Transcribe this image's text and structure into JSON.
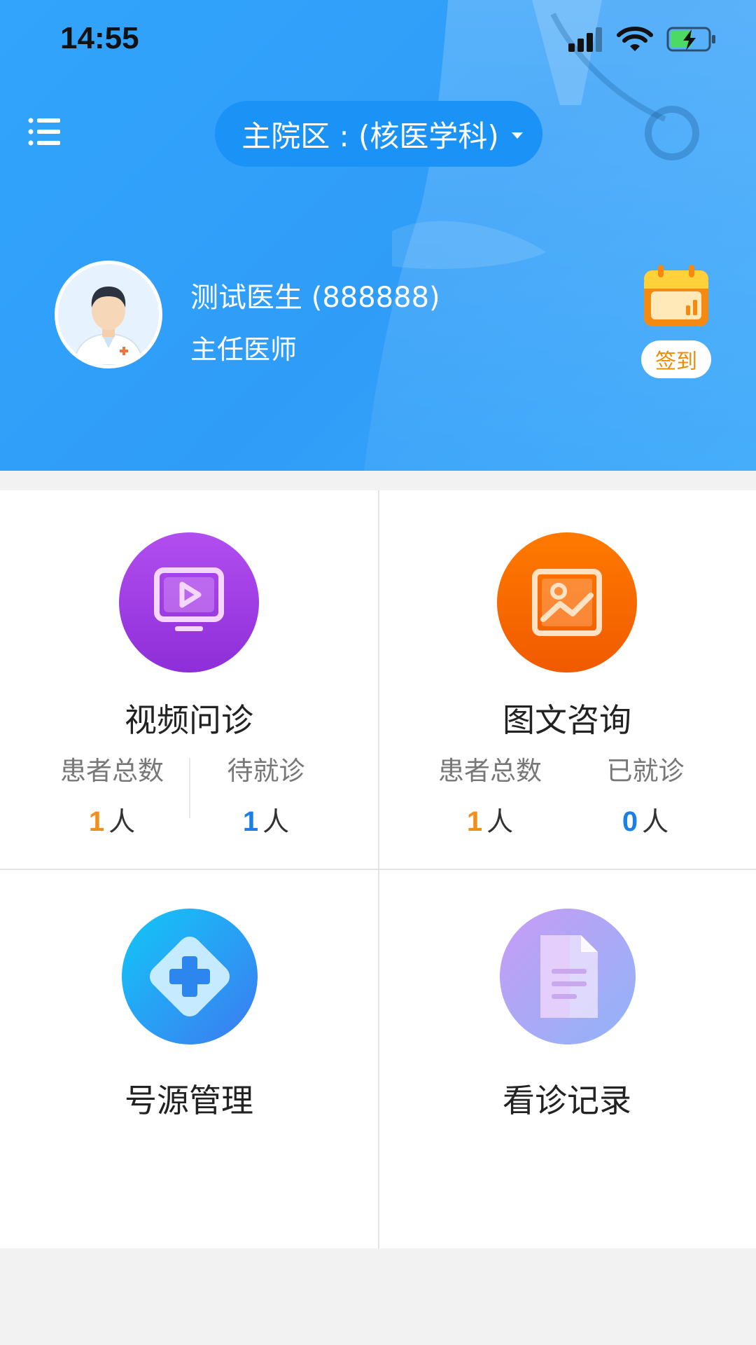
{
  "status": {
    "time": "14:55"
  },
  "header": {
    "campus_label": "主院区 : (核医学科)",
    "doctor_name": "测试医生 (888888)",
    "doctor_title": "主任医师",
    "checkin_label": "签到"
  },
  "cards": {
    "video": {
      "title": "视频问诊",
      "stats": [
        {
          "label": "患者总数",
          "value": "1",
          "unit": "人"
        },
        {
          "label": "待就诊",
          "value": "1",
          "unit": "人"
        }
      ]
    },
    "text": {
      "title": "图文咨询",
      "stats": [
        {
          "label": "患者总数",
          "value": "1",
          "unit": "人"
        },
        {
          "label": "已就诊",
          "value": "0",
          "unit": "人"
        }
      ]
    },
    "source": {
      "title": "号源管理"
    },
    "records": {
      "title": "看诊记录"
    }
  },
  "icons": {
    "menu": "list-menu-icon",
    "calendar": "calendar-icon",
    "video": "video-play-icon",
    "image": "image-chart-icon",
    "medical": "medical-cross-icon",
    "document": "document-icon"
  },
  "colors": {
    "header_blue": "#32a4fb",
    "orange_value": "#f18e1c",
    "blue_value": "#1a80e6",
    "checkin_text": "#f08a00"
  }
}
